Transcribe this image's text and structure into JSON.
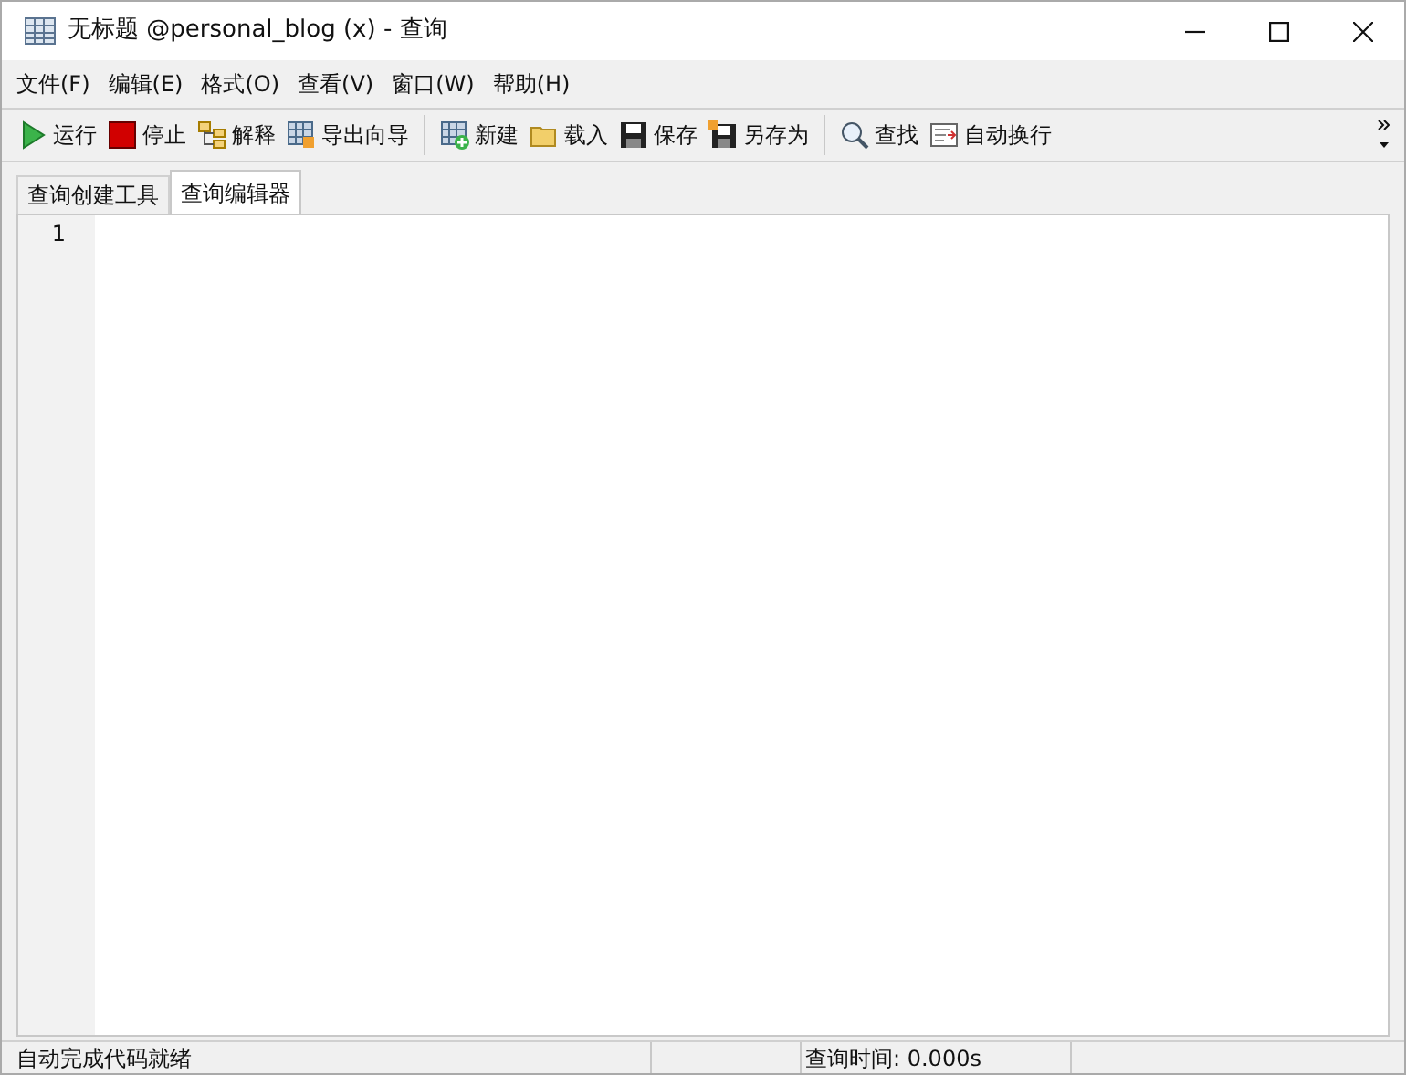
{
  "window": {
    "title": "无标题 @personal_blog (x) - 查询"
  },
  "menu": [
    "文件(F)",
    "编辑(E)",
    "格式(O)",
    "查看(V)",
    "窗口(W)",
    "帮助(H)"
  ],
  "toolbar_groups": [
    [
      {
        "kind": "run",
        "label": "运行"
      },
      {
        "kind": "stop",
        "label": "停止"
      },
      {
        "kind": "explain",
        "label": "解释"
      },
      {
        "kind": "export",
        "label": "导出向导"
      }
    ],
    [
      {
        "kind": "new",
        "label": "新建"
      },
      {
        "kind": "load",
        "label": "载入"
      },
      {
        "kind": "save",
        "label": "保存"
      },
      {
        "kind": "saveas",
        "label": "另存为"
      }
    ],
    [
      {
        "kind": "find",
        "label": "查找"
      },
      {
        "kind": "wrap",
        "label": "自动换行"
      }
    ]
  ],
  "tabs": [
    {
      "label": "查询创建工具",
      "selected": false
    },
    {
      "label": "查询编辑器",
      "selected": true
    }
  ],
  "editor": {
    "line_numbers": [
      "1"
    ]
  },
  "status_bar": {
    "message": "自动完成代码就绪",
    "query_time": "查询时间: 0.000s"
  }
}
